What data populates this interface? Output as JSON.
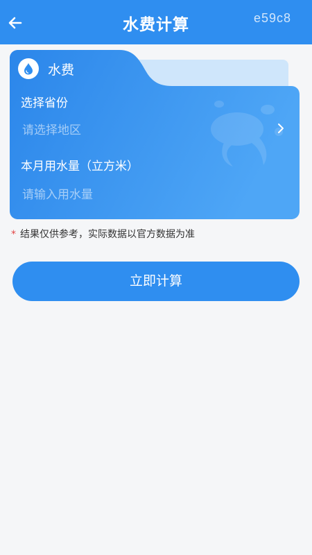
{
  "header": {
    "title": "水费计算",
    "back_icon": "arrow-left-icon",
    "watermark": "e59c8"
  },
  "card": {
    "tab_label": "水费",
    "tab_icon": "water-drop-icon",
    "province_label": "选择省份",
    "province_placeholder": "请选择地区",
    "chevron_icon": "chevron-right-icon",
    "usage_label": "本月用水量（立方米）",
    "usage_placeholder": "请输入用水量"
  },
  "disclaimer": {
    "asterisk": "*",
    "text": "结果仅供参考，实际数据以官方数据为准"
  },
  "calculate_button": "立即计算",
  "colors": {
    "primary": "#2f8ef0",
    "card_dark": "#2b86ea",
    "card_light": "#4ea6f6",
    "background": "#f5f6f8",
    "asterisk": "#e24646"
  }
}
